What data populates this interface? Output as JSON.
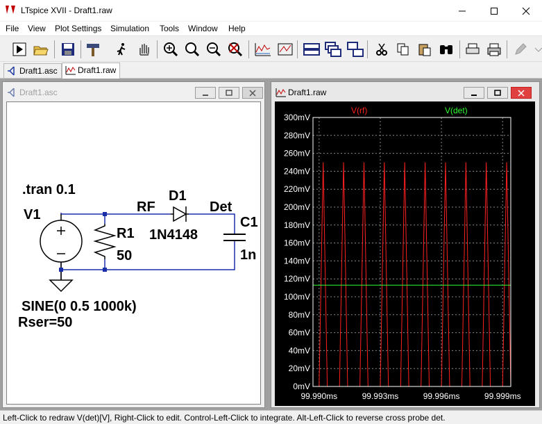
{
  "window": {
    "title": "LTspice XVII - Draft1.raw"
  },
  "menu": [
    "File",
    "View",
    "Plot Settings",
    "Simulation",
    "Tools",
    "Window",
    "Help"
  ],
  "tabs": [
    {
      "label": "Draft1.asc",
      "active": false
    },
    {
      "label": "Draft1.raw",
      "active": true
    }
  ],
  "schematic": {
    "title": "Draft1.asc",
    "directive": ".tran 0.1",
    "v1_name": "V1",
    "v1_value_line1": "SINE(0 0.5 1000k)",
    "v1_value_line2": "Rser=50",
    "r1_name": "R1",
    "r1_value": "50",
    "d1_name": "D1",
    "d1_model": "1N4148",
    "c1_name": "C1",
    "c1_value": "1n",
    "net_rf": "RF",
    "net_det": "Det"
  },
  "plot": {
    "title": "Draft1.raw",
    "trace_rf_label": "V(rf)",
    "trace_det_label": "V(det)"
  },
  "chart_data": {
    "type": "line",
    "title": "",
    "xlabel": "",
    "ylabel": "",
    "grid": true,
    "xlim": [
      99.9897,
      99.9994
    ],
    "ylim": [
      0,
      300
    ],
    "x_ticks": [
      "99.990ms",
      "99.993ms",
      "99.996ms",
      "99.999ms"
    ],
    "x_tick_values": [
      99.99,
      99.993,
      99.996,
      99.999
    ],
    "y_ticks": [
      "0mV",
      "20mV",
      "40mV",
      "60mV",
      "80mV",
      "100mV",
      "120mV",
      "140mV",
      "160mV",
      "180mV",
      "200mV",
      "220mV",
      "240mV",
      "260mV",
      "280mV",
      "300mV"
    ],
    "y_tick_values": [
      0,
      20,
      40,
      60,
      80,
      100,
      120,
      140,
      160,
      180,
      200,
      220,
      240,
      260,
      280,
      300
    ],
    "series": [
      {
        "name": "V(rf)",
        "color": "#ff2020",
        "x": [
          99.99,
          99.9902,
          99.9904,
          99.9906,
          99.991,
          99.9912,
          99.9914,
          99.9916,
          99.992,
          99.9922,
          99.9924,
          99.9926,
          99.993,
          99.9932,
          99.9934,
          99.9936,
          99.994,
          99.9942,
          99.9944,
          99.9946,
          99.995,
          99.9952,
          99.9954,
          99.9956,
          99.996,
          99.9962,
          99.9964,
          99.9966,
          99.997,
          99.9972,
          99.9974,
          99.9976,
          99.998,
          99.9982,
          99.9984,
          99.9986,
          99.999,
          99.9992,
          99.9994
        ],
        "y": [
          0,
          250,
          0,
          0,
          0,
          250,
          0,
          0,
          0,
          250,
          0,
          0,
          0,
          250,
          0,
          0,
          0,
          250,
          0,
          0,
          0,
          250,
          0,
          0,
          0,
          250,
          0,
          0,
          0,
          250,
          0,
          0,
          0,
          250,
          0,
          0,
          0,
          250,
          0
        ]
      },
      {
        "name": "V(det)",
        "color": "#30ff30",
        "x": [
          99.9897,
          99.9994
        ],
        "y": [
          113,
          113
        ]
      }
    ],
    "colors": {
      "background": "#000000",
      "grid": "#8a8a8a",
      "axis_text": "#ffffff"
    }
  },
  "status": {
    "text": "Left-Click to redraw V(det)[V],  Right-Click to edit. Control-Left-Click to integrate. Alt-Left-Click to reverse cross probe det."
  }
}
